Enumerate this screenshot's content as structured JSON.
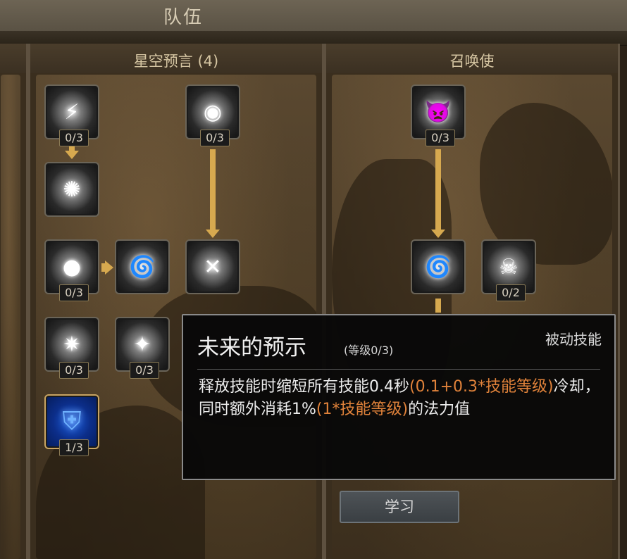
{
  "header": {
    "title": "队伍"
  },
  "columns": [
    {
      "title": "星空预言 (4)"
    },
    {
      "title": "召唤使"
    }
  ],
  "skills_left": [
    {
      "level": "0/3"
    },
    {
      "level": "0/3"
    },
    {
      "level": "0/3"
    },
    {
      "level": "0/3"
    },
    {
      "level": "0/3"
    },
    {
      "level": "1/3"
    }
  ],
  "skills_right": [
    {
      "level": "0/3"
    },
    {
      "level": "0/2"
    }
  ],
  "tooltip": {
    "name": "未来的预示",
    "level": "(等级0/3)",
    "type": "被动技能",
    "desc_parts": [
      "释放技能时缩短所有技能0.4秒",
      "(0.1+0.3*技能等级)",
      "冷却，同时额外消耗1%",
      "(1*技能等级)",
      "的法力值"
    ]
  },
  "learn_button": {
    "label": "学习"
  },
  "colors": {
    "accent": "#d7a94f",
    "highlight": "#e0823a"
  }
}
